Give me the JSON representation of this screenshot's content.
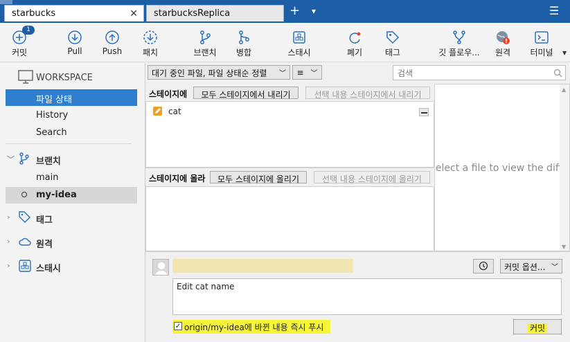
{
  "tabs": [
    {
      "label": "starbucks",
      "close": "✕"
    },
    {
      "label": "starbucksReplica"
    }
  ],
  "tab_add": "+",
  "tab_more": "▾",
  "window_menu": "☰",
  "toolbar": {
    "commit": "커밋",
    "commit_badge": "1",
    "pull": "Pull",
    "push": "Push",
    "patch": "패치",
    "branch": "브랜치",
    "merge": "병합",
    "stash": "스태시",
    "discard": "폐기",
    "tag": "태그",
    "git_flow": "깃 플로우...",
    "remote": "원격",
    "terminal": "터미널"
  },
  "sidebar": {
    "workspace": "WORKSPACE",
    "workspace_items": [
      "파일 상태",
      "History",
      "Search"
    ],
    "branches_header": "브랜치",
    "branches": [
      "main",
      "my-idea"
    ],
    "tags_header": "태그",
    "remotes_header": "원격",
    "stash_header": "스태시"
  },
  "filter": {
    "dropdown": "대기 중인 파일, 파일 상태순 정렬",
    "list_icon": "≡",
    "search_placeholder": "검색"
  },
  "staged": {
    "header": "스테이지에",
    "unstage_all": "모두 스테이지에서 내리기",
    "unstage_selected": "선택 내용 스테이지에서 내리기",
    "files": [
      {
        "name": "cat",
        "status_color": "#f0a020"
      }
    ]
  },
  "unstaged": {
    "header": "스테이지에 올라",
    "stage_all": "모두 스테이지에 올리기",
    "stage_selected": "선택 내용 스테이지에 올리기"
  },
  "diff_placeholder": "Select a file to view the diff",
  "commit_area": {
    "options": "커밋 옵션...",
    "message": "Edit cat name",
    "push_checkbox_label": "origin/my-idea에 바뀐 내용 즉시 푸시",
    "push_checked": true,
    "commit_button": "커밋",
    "highlight_color": "#f7f43a"
  }
}
